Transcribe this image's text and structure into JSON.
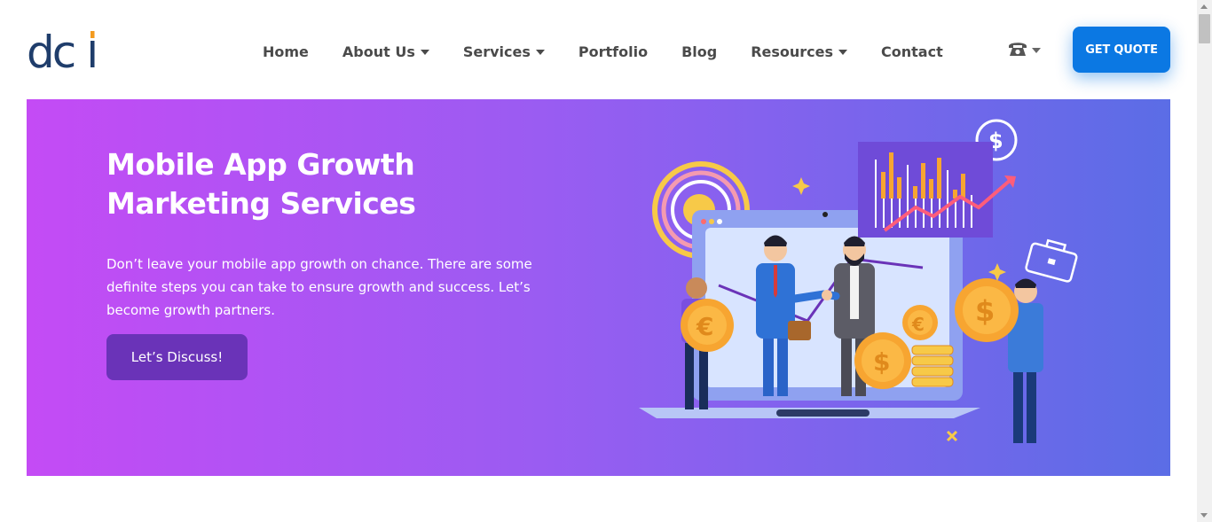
{
  "header": {
    "logo_text": "dci",
    "nav": [
      {
        "label": "Home",
        "has_dropdown": false
      },
      {
        "label": "About Us",
        "has_dropdown": true
      },
      {
        "label": "Services",
        "has_dropdown": true
      },
      {
        "label": "Portfolio",
        "has_dropdown": false
      },
      {
        "label": "Blog",
        "has_dropdown": false
      },
      {
        "label": "Resources",
        "has_dropdown": true
      },
      {
        "label": "Contact",
        "has_dropdown": false
      }
    ],
    "phone_icon": "phone-icon",
    "quote_label": "GET QUOTE"
  },
  "hero": {
    "title_line1": "Mobile App Growth",
    "title_line2": "Marketing Services",
    "description": "Don’t leave your mobile app growth on chance. There are some definite steps you can take to ensure growth and success. Let’s become growth partners.",
    "cta_label": "Let’s Discuss!"
  },
  "colors": {
    "accent": "#0b78e3",
    "hero_gradient_start": "#c44bf5",
    "hero_gradient_end": "#5b6de6",
    "cta": "#6a33b8",
    "logo_blue": "#1f3d6b",
    "logo_orange": "#f39a1e"
  }
}
